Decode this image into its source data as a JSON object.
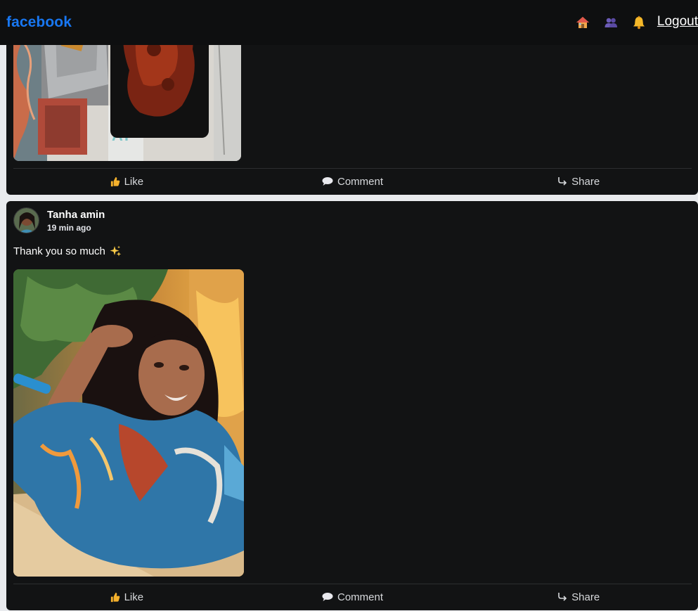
{
  "header": {
    "brand": "facebook",
    "nav_icons": [
      "home-icon",
      "friends-icon",
      "notifications-icon"
    ],
    "logout_label": "Logout"
  },
  "posts": [
    {
      "image": "food-photo",
      "actions": {
        "like": "Like",
        "comment": "Comment",
        "share": "Share"
      }
    },
    {
      "author": "Tanha amin",
      "time": "19 min ago",
      "text": "Thank you so much",
      "text_emoji": "sparkles-icon",
      "image": "selfie-photo",
      "actions": {
        "like": "Like",
        "comment": "Comment",
        "share": "Share"
      }
    }
  ],
  "colors": {
    "brand": "#1877f2",
    "background": "#121314",
    "page": "#e9ebee"
  }
}
